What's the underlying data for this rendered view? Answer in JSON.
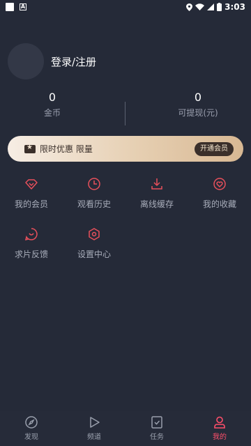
{
  "status_bar": {
    "time": "3:03"
  },
  "profile": {
    "login_label": "登录/注册"
  },
  "stats": {
    "coins": {
      "value": "0",
      "label": "金币"
    },
    "cash": {
      "value": "0",
      "label": "可提现(元)"
    }
  },
  "vip_banner": {
    "text": "限时优惠 限量",
    "button_label": "开通会员"
  },
  "features": [
    {
      "label": "我的会员",
      "icon": "diamond-icon"
    },
    {
      "label": "观看历史",
      "icon": "clock-icon"
    },
    {
      "label": "离线缓存",
      "icon": "download-icon"
    },
    {
      "label": "我的收藏",
      "icon": "heart-icon"
    },
    {
      "label": "求片反馈",
      "icon": "feedback-icon"
    },
    {
      "label": "设置中心",
      "icon": "settings-icon"
    }
  ],
  "tabs": [
    {
      "label": "发现",
      "icon": "compass-icon",
      "active": false
    },
    {
      "label": "频道",
      "icon": "play-icon",
      "active": false
    },
    {
      "label": "任务",
      "icon": "task-icon",
      "active": false
    },
    {
      "label": "我的",
      "icon": "user-icon",
      "active": true
    }
  ],
  "colors": {
    "accent": "#e8505b",
    "active_tab": "#ff4f6b",
    "background": "#252a38"
  }
}
